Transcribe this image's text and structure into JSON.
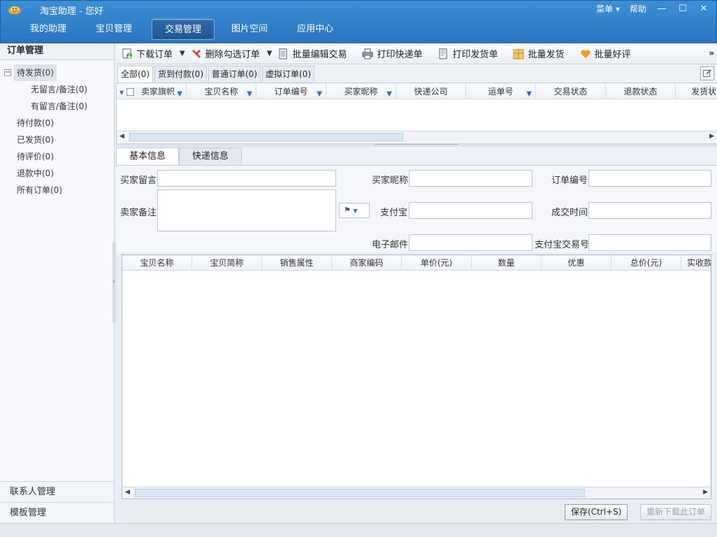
{
  "window": {
    "title": "淘宝助理 - 您好",
    "menu_label": "菜单 ▾",
    "help_label": "帮助",
    "min": "—",
    "max": "☐",
    "close": "✕"
  },
  "nav": [
    "我的助理",
    "宝贝管理",
    "交易管理",
    "图片空间",
    "应用中心"
  ],
  "sidebar": {
    "title": "订单管理",
    "tree": [
      {
        "label": "待发货(0)",
        "level": 0,
        "expanded": true,
        "selected": true
      },
      {
        "label": "无留言/备注(0)",
        "level": 1
      },
      {
        "label": "有留言/备注(0)",
        "level": 1
      },
      {
        "label": "待付款(0)",
        "level": 0
      },
      {
        "label": "已发货(0)",
        "level": 0
      },
      {
        "label": "待评价(0)",
        "level": 0
      },
      {
        "label": "退款中(0)",
        "level": 0
      },
      {
        "label": "所有订单(0)",
        "level": 0
      }
    ],
    "bottom": [
      "联系人管理",
      "模板管理"
    ]
  },
  "toolbar": {
    "download": "下载订单",
    "delete": "删除勾选订单",
    "batch_edit": "批量编辑交易",
    "print_express": "打印快递单",
    "print_ship": "打印发货单",
    "batch_ship": "批量发货",
    "batch_review": "批量好评",
    "more": "»"
  },
  "order_tabs": [
    "全部(0)",
    "货到付款(0)",
    "普通订单(0)",
    "虚拟订单(0)"
  ],
  "order_columns": [
    "卖家旗帜",
    "宝贝名称",
    "订单编号",
    "买家昵称",
    "快递公司",
    "运单号",
    "交易状态",
    "退款状态",
    "发货状"
  ],
  "detail_tabs": [
    "基本信息",
    "快递信息"
  ],
  "form": {
    "buyer_message": "买家留言",
    "seller_note": "卖家备注",
    "buyer_nick": "买家昵称",
    "alipay": "支付宝",
    "email": "电子邮件",
    "order_no": "订单编号",
    "deal_time": "成交时间",
    "alipay_trade_no": "支付宝交易号"
  },
  "item_columns": [
    "宝贝名称",
    "宝贝简称",
    "销售属性",
    "商家编码",
    "单价(元)",
    "数量",
    "优惠",
    "总价(元)",
    "实收款"
  ],
  "buttons": {
    "save": "保存(Ctrl+S)",
    "redownload": "重新下载此订单"
  }
}
